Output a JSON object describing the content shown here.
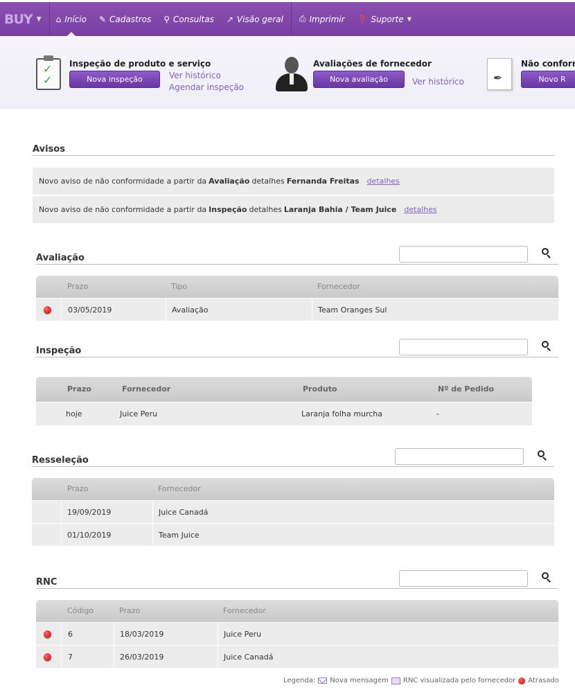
{
  "nav": {
    "brand": "BUY",
    "items": [
      {
        "label": "Início",
        "icon": "home-icon"
      },
      {
        "label": "Cadastros",
        "icon": "pencil-icon"
      },
      {
        "label": "Consultas",
        "icon": "search-icon"
      },
      {
        "label": "Visão geral",
        "icon": "chart-icon"
      },
      {
        "label": "Imprimir",
        "icon": "printer-icon"
      },
      {
        "label": "Suporte",
        "icon": "help-icon"
      }
    ]
  },
  "shortcuts": {
    "inspecao": {
      "title": "Inspeção de produto e serviço",
      "button": "Nova inspeção",
      "link1": "Ver histórico",
      "link2": "Agendar inspeção"
    },
    "avaliacao": {
      "title": "Avaliações de fornecedor",
      "button": "Nova avaliação",
      "link1": "Ver histórico"
    },
    "nc": {
      "title": "Não conforn",
      "button": "Novo R"
    }
  },
  "avisos": {
    "title": "Avisos",
    "items": [
      {
        "pre": "Novo aviso de não conformidade a partir da",
        "kind": "Avaliação",
        "mid": "detalhes",
        "who": "Fernanda Freitas",
        "link": "detalhes"
      },
      {
        "pre": "Novo aviso de não conformidade a partir da",
        "kind": "Inspeção",
        "mid": "detalhes",
        "who": "Laranja Bahia / Team Juice",
        "link": "detalhes"
      }
    ]
  },
  "avaliacao": {
    "title": "Avaliação",
    "headers": [
      "Prazo",
      "Tipo",
      "Fornecedor"
    ],
    "rows": [
      {
        "prazo": "03/05/2019",
        "tipo": "Avaliação",
        "fornecedor": "Team Oranges Sul"
      }
    ]
  },
  "inspecao": {
    "title": "Inspeção",
    "headers": [
      "Prazo",
      "Fornecedor",
      "Produto",
      "Nº de Pedido"
    ],
    "rows": [
      {
        "prazo": "hoje",
        "fornecedor": "Juice Peru",
        "produto": "Laranja folha murcha",
        "pedido": "-"
      }
    ]
  },
  "resselecao": {
    "title": "Resseleção",
    "headers": [
      "Prazo",
      "Fornecedor"
    ],
    "rows": [
      {
        "prazo": "19/09/2019",
        "fornecedor": "Juice Canadá"
      },
      {
        "prazo": "01/10/2019",
        "fornecedor": "Team Juice"
      }
    ]
  },
  "rnc": {
    "title": "RNC",
    "headers": [
      "Código",
      "Prazo",
      "Fornecedor"
    ],
    "rows": [
      {
        "codigo": "6",
        "prazo": "18/03/2019",
        "fornecedor": "Juice Peru"
      },
      {
        "codigo": "7",
        "prazo": "26/03/2019",
        "fornecedor": "Juice Canadá"
      }
    ]
  },
  "legend": {
    "label": "Legenda:",
    "nova": "Nova mensagem",
    "visualizada": "RNC visualizada pelo fornecedor",
    "atrasado": "Atrasado"
  },
  "colors": {
    "accent": "#7a3fa3",
    "link": "#7f65b8",
    "late": "#c40000"
  }
}
